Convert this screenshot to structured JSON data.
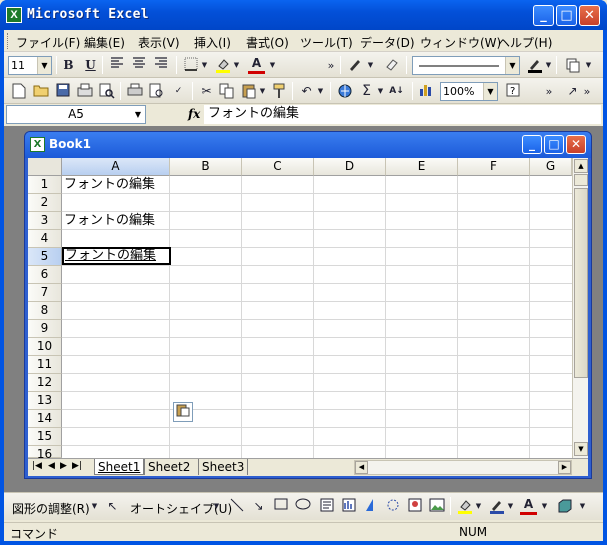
{
  "app": {
    "title": "Microsoft Excel",
    "icon_glyph": "X",
    "minimize": "_",
    "maximize": "□",
    "close": "✕"
  },
  "menu": [
    "ファイル(F)",
    "編集(E)",
    "表示(V)",
    "挿入(I)",
    "書式(O)",
    "ツール(T)",
    "データ(D)",
    "ウィンドウ(W)",
    "ヘルプ(H)"
  ],
  "format_toolbar": {
    "font_size": "11",
    "bold": "B",
    "underline": "U",
    "font_color_glyph": "A"
  },
  "standard_toolbar": {
    "zoom": "100%",
    "sum_glyph": "Σ"
  },
  "formula_bar": {
    "name_box": "A5",
    "fx": "fx",
    "content": "フォントの編集"
  },
  "workbook": {
    "title": "Book1",
    "icon_glyph": "X",
    "columns": [
      "A",
      "B",
      "C",
      "D",
      "E",
      "F",
      "G"
    ],
    "rows": [
      "1",
      "2",
      "3",
      "4",
      "5",
      "6",
      "7",
      "8",
      "9",
      "10",
      "11",
      "12",
      "13",
      "14",
      "15",
      "16"
    ],
    "cells": {
      "A1": "フォントの編集",
      "A3": "フォントの編集",
      "A5": "フォントの編集"
    },
    "selected_column": "A",
    "selected_row": "5",
    "active_cell": "A5",
    "tabs": [
      "Sheet1",
      "Sheet2",
      "Sheet3"
    ],
    "active_tab": "Sheet1"
  },
  "drawing_toolbar": {
    "draw_menu": "図形の調整(R)",
    "autoshapes": "オートシェイプ(U)"
  },
  "status": {
    "mode": "コマンド",
    "num": "NUM"
  },
  "colors": {
    "title_bar": "#0054e3",
    "close_button": "#c8402a",
    "font_color": "#d00000",
    "fill_color": "#ffff00"
  }
}
